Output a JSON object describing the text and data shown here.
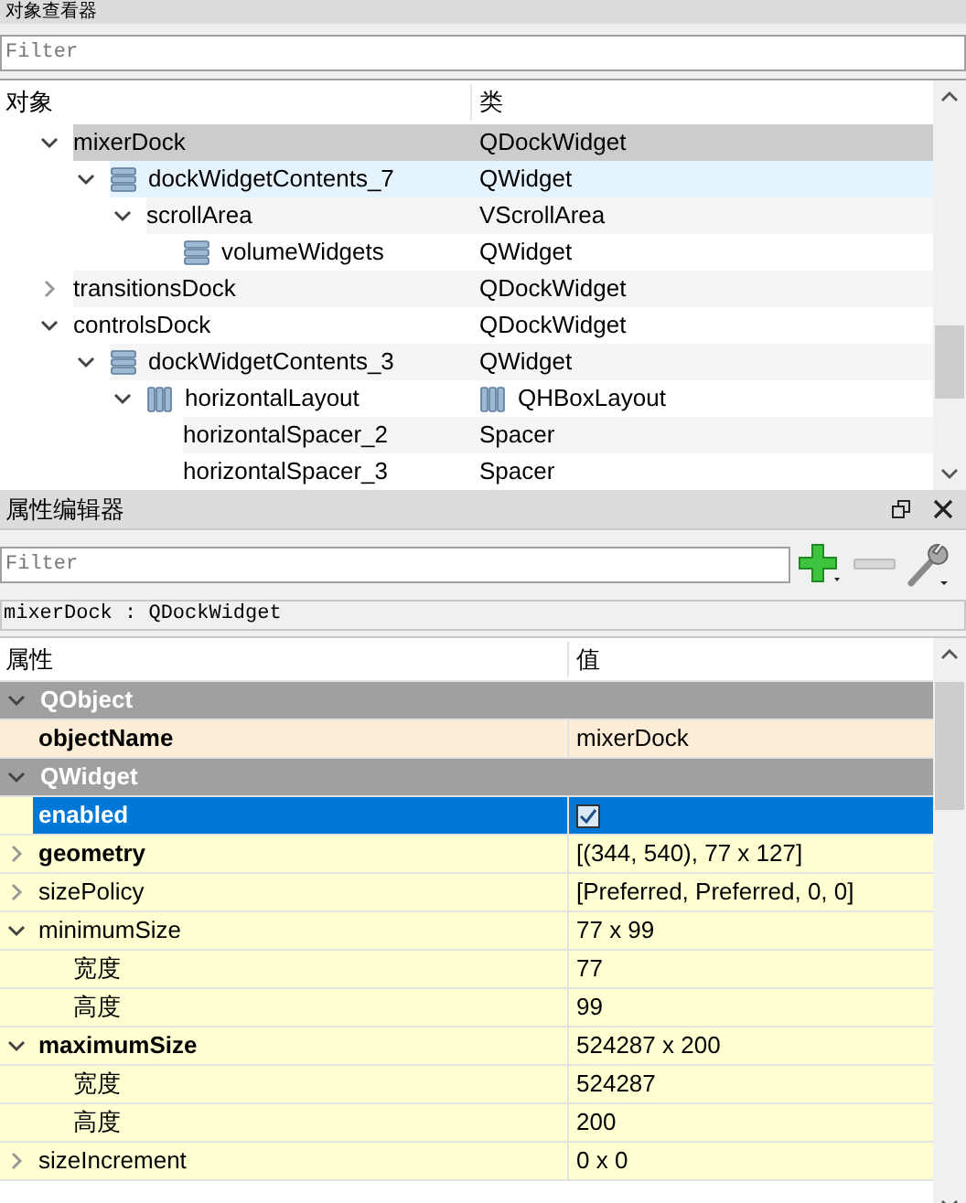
{
  "object_inspector": {
    "title": "对象查看器",
    "filter": {
      "placeholder": "Filter"
    },
    "columns": [
      "对象",
      "类"
    ],
    "tree": [
      {
        "name": "mixerDock",
        "class": "QDockWidget",
        "expanded": true,
        "selected": true,
        "hovered": false,
        "children": [
          {
            "name": "dockWidgetContents_7",
            "class": "QWidget",
            "kind": "widget",
            "expanded": true,
            "selected": false,
            "hovered": true,
            "children": [
              {
                "name": "scrollArea",
                "class": "VScrollArea",
                "expanded": true,
                "selected": false,
                "hovered": false,
                "children": [
                  {
                    "name": "volumeWidgets",
                    "class": "QWidget",
                    "kind": "widget",
                    "selected": false,
                    "hovered": false
                  }
                ]
              }
            ]
          }
        ]
      },
      {
        "name": "transitionsDock",
        "class": "QDockWidget",
        "expanded": false,
        "selected": false,
        "hovered": false
      },
      {
        "name": "controlsDock",
        "class": "QDockWidget",
        "expanded": true,
        "selected": false,
        "hovered": false,
        "children": [
          {
            "name": "dockWidgetContents_3",
            "class": "QWidget",
            "kind": "widget",
            "expanded": true,
            "selected": false,
            "hovered": false,
            "children": [
              {
                "name": "horizontalLayout",
                "class": "QHBoxLayout",
                "kind": "layout",
                "expanded": true,
                "selected": false,
                "hovered": false,
                "children": [
                  {
                    "name": "horizontalSpacer_2",
                    "class": "Spacer",
                    "selected": false,
                    "hovered": false
                  },
                  {
                    "name": "horizontalSpacer_3",
                    "class": "Spacer",
                    "selected": false,
                    "hovered": false
                  }
                ]
              }
            ]
          }
        ]
      }
    ]
  },
  "property_editor": {
    "title": "属性编辑器",
    "filter": {
      "placeholder": "Filter"
    },
    "breadcrumb": "mixerDock : QDockWidget",
    "columns": [
      "属性",
      "值"
    ],
    "groups": [
      {
        "name": "QObject",
        "expanded": true,
        "color": "#fdecd6",
        "properties": [
          {
            "name": "objectName",
            "kind": "text",
            "value": "mixerDock",
            "modified": true,
            "selected": false
          }
        ]
      },
      {
        "name": "QWidget",
        "expanded": true,
        "color": "#ffffd2",
        "properties": [
          {
            "name": "enabled",
            "kind": "checkbox",
            "checked": true,
            "modified": true,
            "selected": true
          },
          {
            "name": "geometry",
            "kind": "text",
            "value": "[(344, 540), 77 x 127]",
            "modified": true,
            "selected": false,
            "expanded": false
          },
          {
            "name": "sizePolicy",
            "kind": "text",
            "value": "[Preferred, Preferred, 0, 0]",
            "modified": false,
            "selected": false,
            "expanded": false
          },
          {
            "name": "minimumSize",
            "kind": "text",
            "value": "77 x 99",
            "modified": false,
            "selected": false,
            "expanded": true,
            "children": [
              {
                "name": "宽度",
                "kind": "text",
                "value": "77",
                "modified": false,
                "selected": false
              },
              {
                "name": "高度",
                "kind": "text",
                "value": "99",
                "modified": false,
                "selected": false
              }
            ]
          },
          {
            "name": "maximumSize",
            "kind": "text",
            "value": "524287 x 200",
            "modified": true,
            "selected": false,
            "expanded": true,
            "children": [
              {
                "name": "宽度",
                "kind": "text",
                "value": "524287",
                "modified": false,
                "selected": false
              },
              {
                "name": "高度",
                "kind": "text",
                "value": "200",
                "modified": false,
                "selected": false
              }
            ]
          },
          {
            "name": "sizeIncrement",
            "kind": "text",
            "value": "0 x 0",
            "modified": false,
            "selected": false,
            "expanded": false
          }
        ]
      }
    ]
  }
}
